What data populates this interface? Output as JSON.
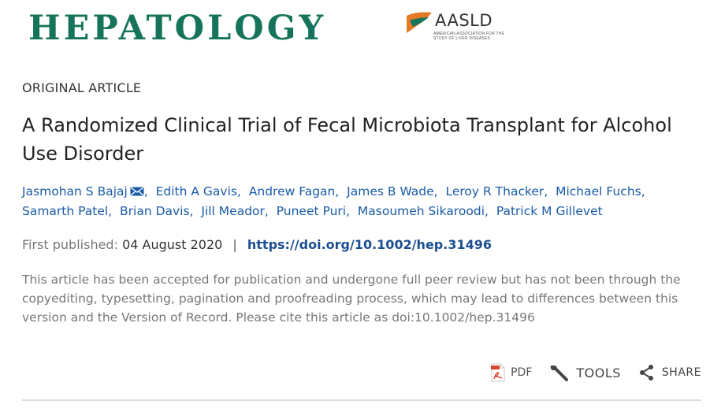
{
  "journal": {
    "name": "HEPATOLOGY",
    "society_logo_text": "AASLD",
    "society_full_name": "American Association for the Study of Liver Diseases",
    "brand_color": "#16745a",
    "logo_orange": "#e57a24"
  },
  "article": {
    "type": "ORIGINAL ARTICLE",
    "title": "A Randomized Clinical Trial of Fecal Microbiota Transplant for Alcohol Use Disorder",
    "authors": [
      {
        "name": "Jasmohan S Bajaj",
        "corresponding": true
      },
      {
        "name": "Edith A Gavis"
      },
      {
        "name": "Andrew Fagan"
      },
      {
        "name": "James B Wade"
      },
      {
        "name": "Leroy R Thacker"
      },
      {
        "name": "Michael Fuchs"
      },
      {
        "name": "Samarth Patel"
      },
      {
        "name": "Brian Davis"
      },
      {
        "name": "Jill Meador"
      },
      {
        "name": "Puneet Puri"
      },
      {
        "name": "Masoumeh Sikaroodi"
      },
      {
        "name": "Patrick M Gillevet"
      }
    ],
    "author_separator": ",",
    "first_published_label": "First published:",
    "first_published_date": "04 August 2020",
    "pipe": "|",
    "doi_url": "https://doi.org/10.1002/hep.31496",
    "notice": "This article has been accepted for publication and undergone full peer review but has not been through the copyediting, typesetting, pagination and proofreading process, which may lead to differences between this version and the Version of Record. Please cite this article as doi:10.1002/hep.31496"
  },
  "actions": {
    "pdf_label": "PDF",
    "tools_label": "TOOLS",
    "share_label": "SHARE"
  },
  "icons": {
    "mail": "envelope-icon",
    "pdf": "pdf-file-icon",
    "tools": "wrench-icon",
    "share": "share-icon"
  },
  "colors": {
    "link": "#1a5ba6",
    "doi": "#1d4f91",
    "muted": "#777777",
    "pdf_red": "#d9442b"
  }
}
